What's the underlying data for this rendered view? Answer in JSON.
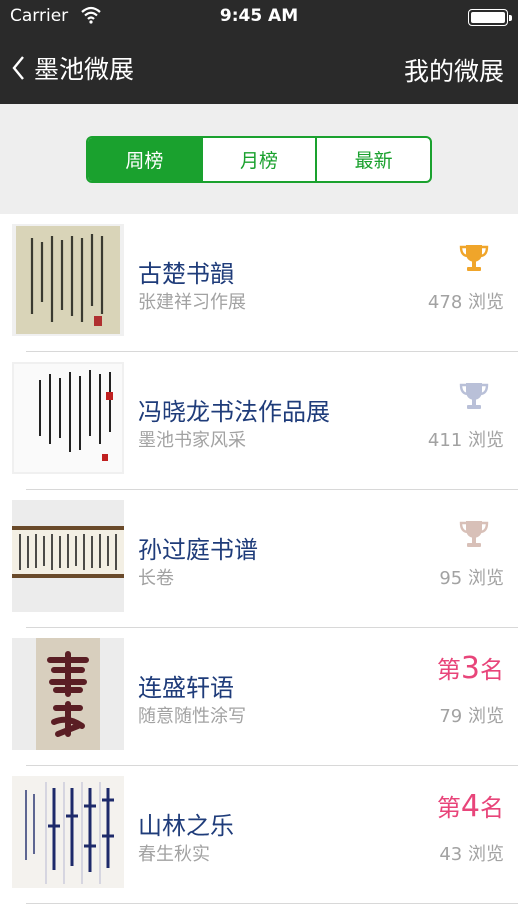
{
  "status_bar": {
    "carrier": "Carrier",
    "time": "9:45 AM"
  },
  "nav": {
    "back_label": "墨池微展",
    "right_label": "我的微展"
  },
  "segments": [
    {
      "label": "周榜",
      "active": true
    },
    {
      "label": "月榜",
      "active": false
    },
    {
      "label": "最新",
      "active": false
    }
  ],
  "items": [
    {
      "title": "古楚书韻",
      "subtitle": "张建祥习作展",
      "views": "478 浏览",
      "badge": "trophy-gold",
      "badge_color": "#f0a52a"
    },
    {
      "title": "冯晓龙书法作品展",
      "subtitle": "墨池书家风采",
      "views": "411 浏览",
      "badge": "trophy-silver",
      "badge_color": "#b9c0d8"
    },
    {
      "title": "孙过庭书谱",
      "subtitle": "长卷",
      "views": "95 浏览",
      "badge": "trophy-bronze",
      "badge_color": "#d8c0b8"
    },
    {
      "title": "连盛轩语",
      "subtitle": "随意随性涂写",
      "views": "79 浏览",
      "rank_prefix": "第",
      "rank_number": "3",
      "rank_suffix": "名"
    },
    {
      "title": "山林之乐",
      "subtitle": "春生秋实",
      "views": "43 浏览",
      "rank_prefix": "第",
      "rank_number": "4",
      "rank_suffix": "名"
    }
  ],
  "colors": {
    "accent": "#1aa12e",
    "rank": "#e8457a",
    "title": "#1f3c7a",
    "nav_bg": "#2a2a2a"
  }
}
